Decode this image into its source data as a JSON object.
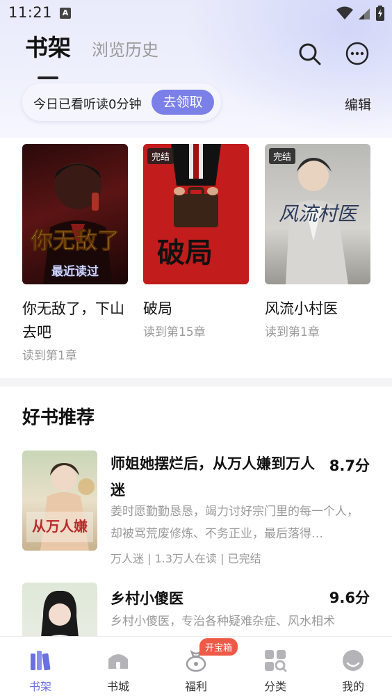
{
  "status_bar": {
    "time": "11:21",
    "notif_letter": "A"
  },
  "header": {
    "tab_shelf": "书架",
    "tab_history": "浏览历史",
    "promo_text": "今日已看听读0分钟",
    "promo_button": "去领取",
    "edit": "编辑"
  },
  "shelf": [
    {
      "title": "你无敌了，下山去吧",
      "progress": "读到第1章",
      "cover_text": "你无敌了",
      "overlay": "最近读过"
    },
    {
      "title": "破局",
      "progress": "读到第15章",
      "cover_text": "破局",
      "badge": "完结"
    },
    {
      "title": "风流小村医",
      "progress": "读到第1章",
      "cover_text": "风流村医",
      "badge": "完结"
    }
  ],
  "recommend": {
    "section_title": "好书推荐",
    "items": [
      {
        "title": "师姐她摆烂后，从万人嫌到万人迷",
        "score": "8.7分",
        "desc": "姜时愿勤勤恳恳，竭力讨好宗门里的每一个人，却被骂荒废修炼、不务正业，最后落得…",
        "meta": "万人迷 | 1.3万人在读 | 已完结"
      },
      {
        "title": "乡村小傻医",
        "score": "9.6分",
        "desc": "乡村小傻医，专治各种疑难杂症、风水相术",
        "meta": ""
      }
    ]
  },
  "bottom_nav": {
    "items": [
      {
        "label": "书架",
        "icon": "bookshelf-icon",
        "active": true
      },
      {
        "label": "书城",
        "icon": "store-icon"
      },
      {
        "label": "福利",
        "icon": "welfare-bag-icon"
      },
      {
        "label": "分类",
        "icon": "category-icon"
      },
      {
        "label": "我的",
        "icon": "profile-icon"
      }
    ],
    "welfare_badge": "开宝箱"
  },
  "colors": {
    "accent": "#7b7fe8",
    "badge": "#ef5a48"
  }
}
